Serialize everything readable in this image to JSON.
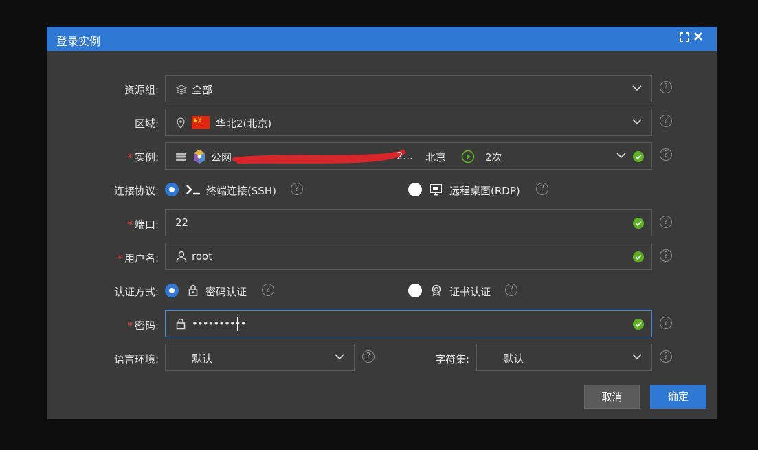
{
  "dialog": {
    "title": "登录实例",
    "resource_group": {
      "label": "资源组:",
      "value": "全部"
    },
    "region": {
      "label": "区域:",
      "value": "华北2(北京)"
    },
    "instance": {
      "required_mark": "*",
      "label": "实例:",
      "value_prefix": "公网",
      "value_mid": "2...",
      "location": "北京",
      "count": "2次"
    },
    "protocol": {
      "label": "连接协议:",
      "options": [
        {
          "label": "终端连接(SSH)",
          "selected": true
        },
        {
          "label": "远程桌面(RDP)",
          "selected": false
        }
      ]
    },
    "port": {
      "required_mark": "*",
      "label": "端口:",
      "value": "22"
    },
    "username": {
      "required_mark": "*",
      "label": "用户名:",
      "value": "root"
    },
    "auth": {
      "label": "认证方式:",
      "options": [
        {
          "label": "密码认证",
          "selected": true
        },
        {
          "label": "证书认证",
          "selected": false
        }
      ]
    },
    "password": {
      "required_mark": "*",
      "label": "密码:",
      "value": "••••••••••"
    },
    "language": {
      "label": "语言环境:",
      "value": "默认"
    },
    "charset": {
      "label": "字符集:",
      "value": "默认"
    },
    "buttons": {
      "cancel": "取消",
      "confirm": "确定"
    },
    "help_glyph": "?",
    "colors": {
      "title_bar": "#2f78d3",
      "success": "#5eb124",
      "required": "#e8392e",
      "focus_border": "#3c8de8"
    }
  }
}
